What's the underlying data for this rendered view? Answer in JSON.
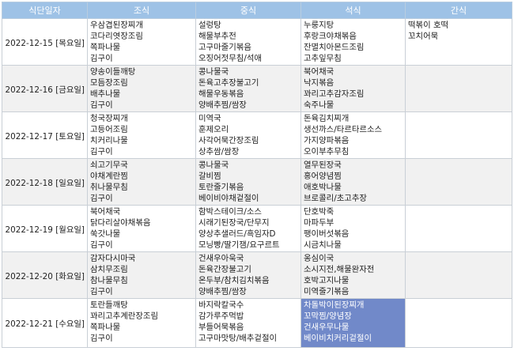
{
  "headers": [
    "식단일자",
    "조식",
    "중식",
    "석식",
    "간식"
  ],
  "rows": [
    {
      "date": "2022-12-15 [목요일]",
      "breakfast": [
        "우삼겹된장찌개",
        "코다리엿장조림",
        "쪽파나물",
        "김구이"
      ],
      "lunch": [
        "설렁탕",
        "해물부추전",
        "고구마줄기볶음",
        "오징어젓무침/석애"
      ],
      "dinner": [
        "누룽지탕",
        "후랑크야채볶음",
        "잔멸치아몬드조림",
        "고추잎무침"
      ],
      "snack": [
        "떡볶이 호떡",
        " 꼬치어묵"
      ]
    },
    {
      "date": "2022-12-16 [금요일]",
      "breakfast": [
        "양송이들깨탕",
        "모듬장조림",
        "배추나물",
        "김구이"
      ],
      "lunch": [
        "콩나물국",
        "돈육고추장불고기",
        "해물우동볶음",
        "양배추찜/쌈장"
      ],
      "dinner": [
        "북어채국",
        "낙지볶음",
        "꽈리고추감자조림",
        "숙주나물"
      ],
      "snack": []
    },
    {
      "date": "2022-12-17 [토요일]",
      "breakfast": [
        "청국장찌개",
        "고등어조림",
        "치커리나물",
        "김구이"
      ],
      "lunch": [
        "미역국",
        "훈제오리",
        "사각어묵간장조림",
        "상추쌈/쌈장"
      ],
      "dinner": [
        "돈육김치찌개",
        "생선까스/타르타르소스",
        "가지양파볶음",
        "오이부추무침"
      ],
      "snack": []
    },
    {
      "date": "2022-12-18 [일요일]",
      "breakfast": [
        "쇠고기무국",
        "야채계란찜",
        "취나물무침",
        "김구이"
      ],
      "lunch": [
        "콩나물국",
        "갈비찜",
        "토란줄기볶음",
        "베이비야채겉절이"
      ],
      "dinner": [
        "열무된장국",
        "홍어양념찜",
        "애호박나물",
        "브로콜리/초고추장"
      ],
      "snack": []
    },
    {
      "date": "2022-12-19 [월요일]",
      "breakfast": [
        "북어채국",
        "닭다리살야채볶음",
        "쑥갓나물",
        "김구이"
      ],
      "lunch": [
        "함박스테이크/소스",
        "시래기된장국/단무지",
        "양상추샐러드/흑임자D",
        "모닝빵/딸기잼/요구르트"
      ],
      "dinner": [
        "단호박죽",
        "마파두부",
        "팽이버섯볶음",
        "시금치나물"
      ],
      "snack": []
    },
    {
      "date": "2022-12-20 [화요일]",
      "breakfast": [
        "감자다시마국",
        "삼치무조림",
        "참나물무침",
        "김구이"
      ],
      "lunch": [
        "건새우아욱국",
        "돈육간장불고기",
        "온두부/참치김치볶음",
        "양배추찜/쌈장"
      ],
      "dinner": [
        "옹심이국",
        "소시지전,해물완자전",
        "호박고지나물",
        "미역줄기볶음"
      ],
      "snack": []
    },
    {
      "date": "2022-12-21 [수요일]",
      "breakfast": [
        "토란들깨탕",
        "꽈리고추계란장조림",
        "쪽파나물",
        "김구이"
      ],
      "lunch": [
        "바지락칼국수",
        "감가루주먹밥",
        "부들어묵볶음",
        "고구마맛탕/배추겉절이"
      ],
      "dinner": [
        "차돌박이된장찌개",
        "꼬막찜/양념장",
        "건새우무나물",
        "베이비치커리겉절이"
      ],
      "snack": []
    }
  ],
  "colors": {
    "header_bg": "#9ec2e6",
    "alt_row_bg": "#f1f1f1",
    "highlight_bg": "#7189c9"
  }
}
